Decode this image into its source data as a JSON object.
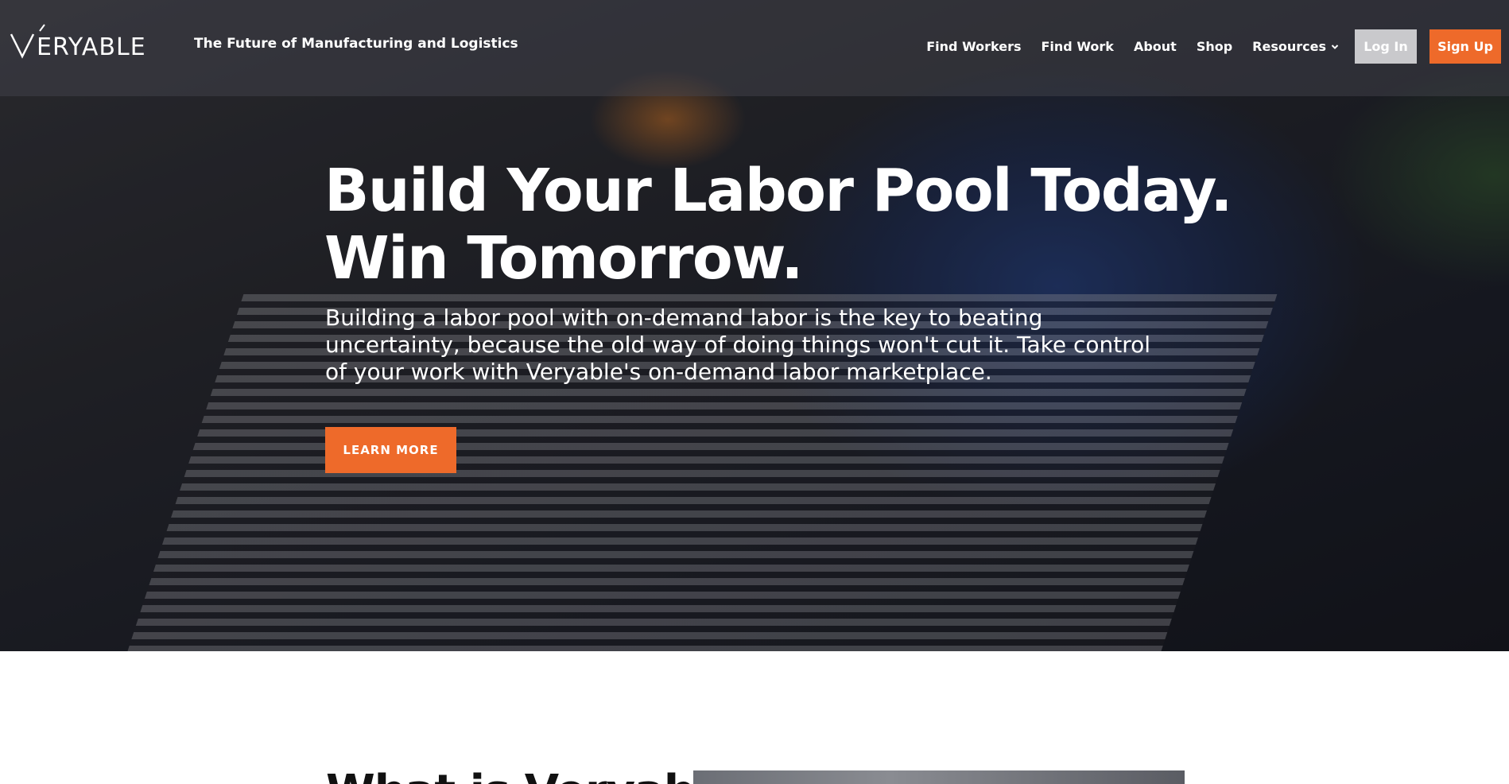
{
  "header": {
    "logo_text": "VERYABLE",
    "tagline": "The Future of Manufacturing and Logistics",
    "nav": [
      {
        "label": "Find Workers"
      },
      {
        "label": "Find Work"
      },
      {
        "label": "About"
      },
      {
        "label": "Shop"
      },
      {
        "label": "Resources",
        "icon": "chevron-down-icon"
      }
    ],
    "login_label": "Log In",
    "signup_label": "Sign Up"
  },
  "hero": {
    "headline_line1": "Build Your Labor Pool Today.",
    "headline_line2": "Win Tomorrow.",
    "subtext": "Building a labor pool with on-demand labor is the key to beating uncertainty, because the old way of doing things won't cut it. Take control of your work with Veryable's on-demand labor marketplace.",
    "cta_label": "LEARN MORE"
  },
  "section": {
    "heading": "What is Veryable?"
  },
  "colors": {
    "accent": "#ee6a2a",
    "login_bg": "#c9c9cc",
    "text_light": "#ffffff"
  }
}
